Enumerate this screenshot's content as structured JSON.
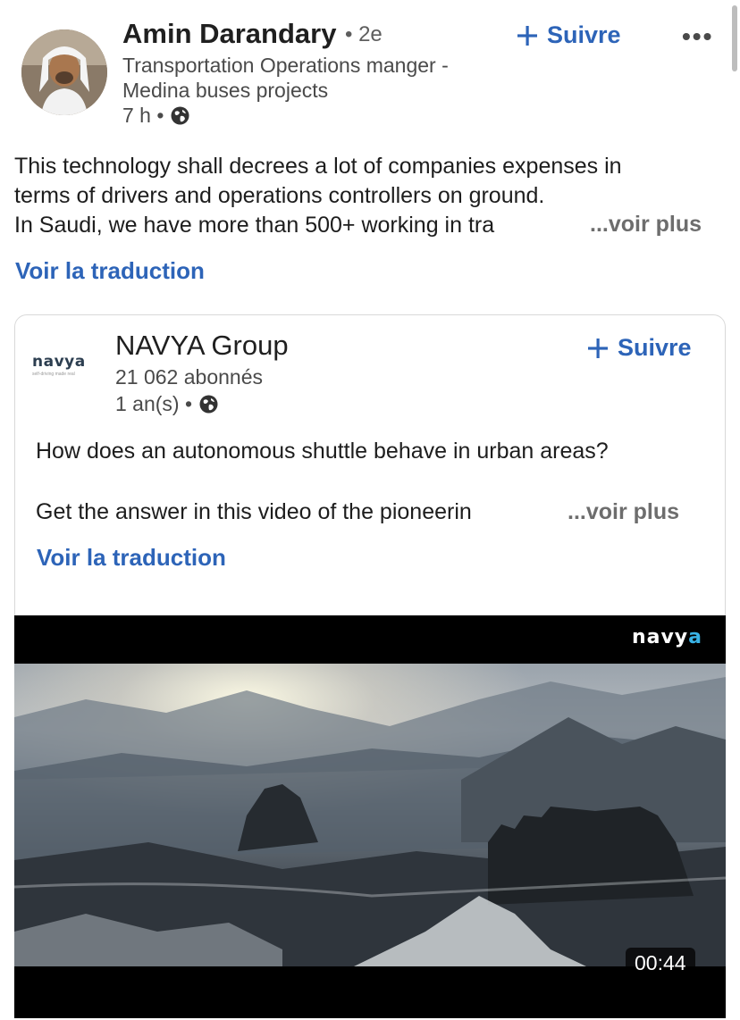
{
  "author": {
    "name": "Amin Darandary",
    "degree": "• 2e",
    "headline": "Transportation Operations manger - Medina buses projects",
    "time": "7 h •",
    "follow_label": "Suivre",
    "more_label": "•••"
  },
  "post": {
    "lines": [
      "This technology shall decrees a lot of companies expenses in",
      "terms of drivers and operations controllers on ground.",
      "In Saudi, we have more than 500+ working in tra"
    ],
    "see_more": "...voir plus",
    "translate": "Voir la traduction"
  },
  "shared": {
    "logo_text": "navya",
    "logo_tagline": "self-driving made real",
    "company_name": "NAVYA Group",
    "followers": "21 062 abonnés",
    "time": "1 an(s) •",
    "follow_label": "Suivre",
    "text_line1": "How does an autonomous shuttle behave in urban areas?",
    "text_line2": "Get the answer in this video of the pioneerin",
    "see_more": "...voir plus",
    "translate": "Voir la traduction"
  },
  "video": {
    "watermark_main": "navy",
    "watermark_accent": "a",
    "duration": "00:44"
  },
  "colors": {
    "link_blue": "#2d64b8",
    "muted_text": "#4a4a4a"
  },
  "icons": [
    "plus-icon",
    "globe-icon",
    "more-icon"
  ]
}
